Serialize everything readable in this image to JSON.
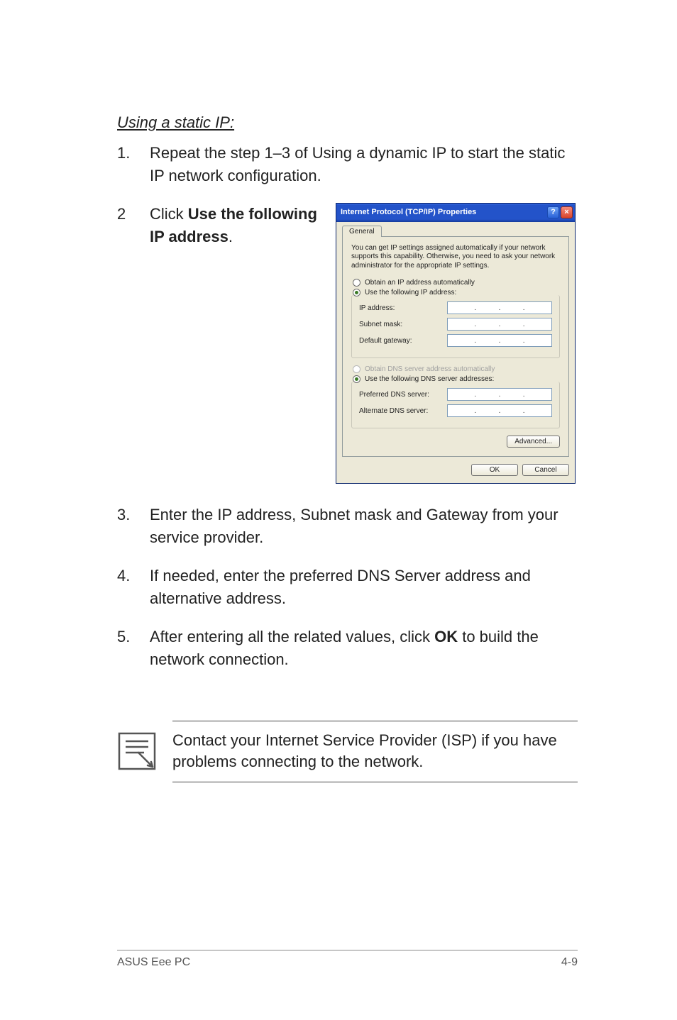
{
  "heading": "Using a static IP:",
  "steps": {
    "s1": {
      "num": "1.",
      "text": "Repeat the step 1–3 of Using a dynamic IP to start the static IP network configuration."
    },
    "s2": {
      "num": "2",
      "pre": "Click ",
      "bold": "Use the following IP address",
      "post": "."
    },
    "s3": {
      "num": "3.",
      "text": "Enter the IP address, Subnet mask and Gateway from your service provider."
    },
    "s4": {
      "num": "4.",
      "text": "If needed, enter the preferred DNS Server address and alternative address."
    },
    "s5": {
      "num": "5.",
      "pre": "After entering all the related values, click ",
      "bold": "OK",
      "post": " to build the network connection."
    }
  },
  "note": "Contact your Internet Service Provider (ISP) if you have problems connecting to the network.",
  "footer": {
    "left": "ASUS Eee PC",
    "right": "4-9"
  },
  "dialog": {
    "title": "Internet Protocol (TCP/IP) Properties",
    "help": "?",
    "close": "×",
    "tab": "General",
    "info": "You can get IP settings assigned automatically if your network supports this capability. Otherwise, you need to ask your network administrator for the appropriate IP settings.",
    "radioAuto": "Obtain an IP address automatically",
    "radioStatic": "Use the following IP address:",
    "ipLabel": "IP address:",
    "subnetLabel": "Subnet mask:",
    "gatewayLabel": "Default gateway:",
    "radioDnsAuto": "Obtain DNS server address automatically",
    "radioDnsStatic": "Use the following DNS server addresses:",
    "prefDns": "Preferred DNS server:",
    "altDns": "Alternate DNS server:",
    "advanced": "Advanced...",
    "ok": "OK",
    "cancel": "Cancel"
  }
}
